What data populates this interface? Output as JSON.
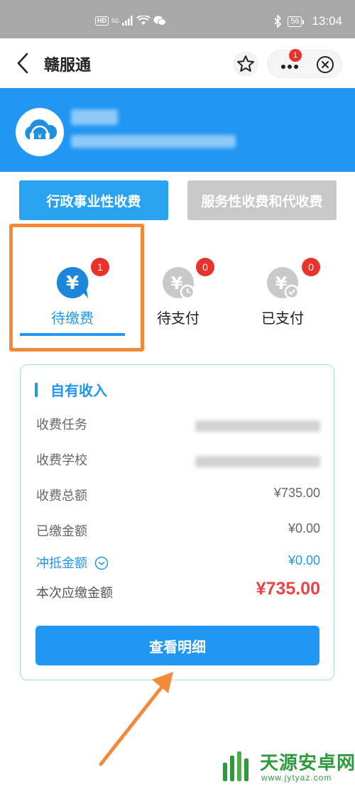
{
  "status_bar": {
    "hd": "HD",
    "signal": "5G",
    "time": "13:04",
    "battery": "56"
  },
  "nav": {
    "title": "赣服通",
    "more_badge": "1"
  },
  "categories": {
    "active": "行政事业性收费",
    "inactive": "服务性收费和代收费"
  },
  "tabs": [
    {
      "label": "待缴费",
      "badge": "1",
      "active": true
    },
    {
      "label": "待支付",
      "badge": "0",
      "active": false
    },
    {
      "label": "已支付",
      "badge": "0",
      "active": false
    }
  ],
  "card": {
    "title": "自有收入",
    "rows": {
      "task_label": "收费任务",
      "school_label": "收费学校",
      "total_label": "收费总额",
      "total_value": "¥735.00",
      "paid_label": "已缴金额",
      "paid_value": "¥0.00",
      "offset_label": "冲抵金额",
      "offset_value": "¥0.00",
      "due_label": "本次应缴金额",
      "due_value": "¥735.00"
    },
    "detail_button": "查看明细"
  },
  "watermark": {
    "name": "天源安卓网",
    "url": "www.jytyaz.com"
  },
  "colors": {
    "primary": "#2196f3",
    "badge": "#e8322b",
    "highlight": "#f28a3a",
    "amount_due": "#e84646"
  }
}
